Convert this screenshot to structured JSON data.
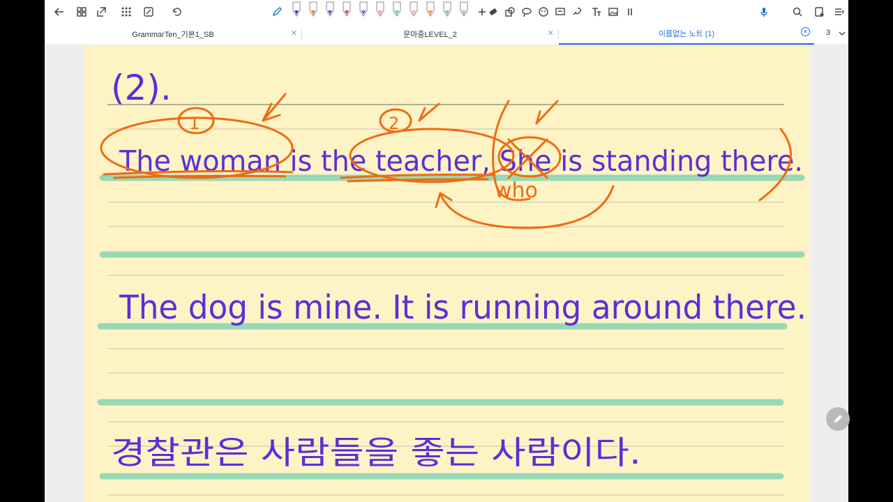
{
  "toolbar": {
    "left_icons": [
      "back-arrow-icon",
      "grid-view-icon",
      "page-export-icon",
      "apps-grid-icon",
      "edit-page-icon",
      "undo-icon"
    ],
    "pens": [
      {
        "name": "pen-blue",
        "color": "#1e3fd8"
      },
      {
        "name": "pen-orange",
        "color": "#f07a16"
      },
      {
        "name": "pen-purple",
        "color": "#7a2fd8"
      },
      {
        "name": "pen-pink",
        "color": "#e0308a"
      },
      {
        "name": "pen-purple-2",
        "color": "#8a52e0"
      },
      {
        "name": "highlighter-pink",
        "color": "#f59ac8"
      },
      {
        "name": "highlighter-green",
        "color": "#68d3a0"
      },
      {
        "name": "highlighter-pink-2",
        "color": "#f7a6d2"
      },
      {
        "name": "highlighter-orange",
        "color": "#f39a4a"
      },
      {
        "name": "highlighter-teal",
        "color": "#5ad0b8"
      },
      {
        "name": "highlighter-gray",
        "color": "#b9b9b9"
      }
    ],
    "right_icons": [
      "eraser-icon",
      "shapes-icon",
      "lasso-icon",
      "sticker-icon",
      "text-box-icon",
      "link-icon",
      "text-tool-icon",
      "image-icon",
      "more-icon",
      "voice-record-icon",
      "search-icon",
      "add-page-icon",
      "menu-icon"
    ]
  },
  "tabs": [
    {
      "label": "GrammarTen_기본1_SB",
      "active": false
    },
    {
      "label": "문마중LEVEL_2",
      "active": false
    },
    {
      "label": "이름없는 노트 (1)",
      "active": true
    }
  ],
  "page_count": "3",
  "note": {
    "line1": "(2).",
    "line2": "The woman is the teacher, She is standing there.",
    "line3": "The dog is mine. It is running around there.",
    "line4": "경찰관은 사람들을 좋는 사람이다.",
    "annotations": [
      "1",
      "2",
      "who"
    ]
  },
  "colors": {
    "paper": "#fdf3c5",
    "ink_purple": "#5a2fd6",
    "ink_orange": "#f06a12",
    "highlight_green": "#8fd8b4",
    "rule_line": "#b4d6c8",
    "accent_blue": "#1e6fd8"
  }
}
